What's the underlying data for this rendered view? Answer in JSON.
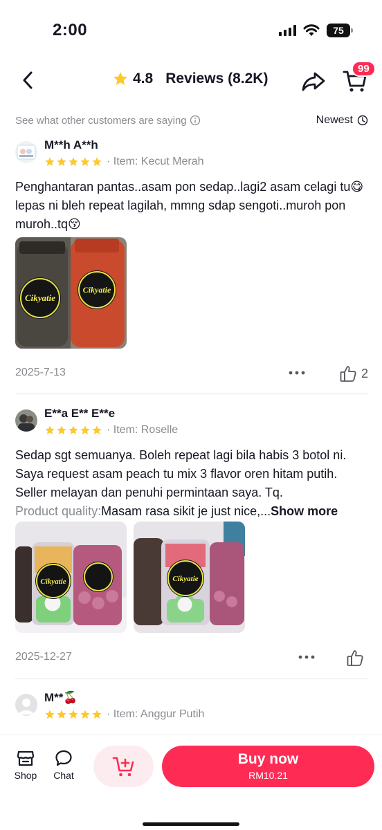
{
  "status_bar": {
    "time": "2:00",
    "battery": "75"
  },
  "header": {
    "rating": "4.8",
    "reviews_label": "Reviews (8.2K)",
    "cart_badge": "99",
    "accent_color": "#fe2c55",
    "star_color": "#fcc92d"
  },
  "subheader": {
    "left_text": "See what other customers are saying",
    "sort_label": "Newest"
  },
  "reviews": [
    {
      "name": "M**h A**h",
      "rating": 5,
      "item": "· Item: Kecut Merah",
      "text": "Penghantaran pantas..asam pon sedap..lagi2 asam celagi tu😋lepas ni bleh repeat lagilah, mmng sdap sengoti..muroh pon muroh..tq😚",
      "photo_count": 1,
      "date": "2025-7-13",
      "likes": "2"
    },
    {
      "name": "E**a E** E**e",
      "rating": 5,
      "item": "· Item: Roselle",
      "text": "Sedap sgt semuanya. Boleh repeat lagi bila habis 3 botol ni. Saya request asam peach tu mix 3 flavor oren hitam putih. Seller melayan dan penuhi permintaan saya. Tq.",
      "quality_label": "Product quality:",
      "quality_text": "Masam rasa sikit je just nice,...",
      "show_more": "Show more",
      "photo_count": 2,
      "date": "2025-12-27",
      "likes": ""
    },
    {
      "name": "M**🍒",
      "rating": 5,
      "item": "· Item: Anggur Putih"
    }
  ],
  "product_label": "Cikyatie",
  "bottom_bar": {
    "shop_label": "Shop",
    "chat_label": "Chat",
    "buy_label": "Buy now",
    "price": "RM10.21"
  }
}
